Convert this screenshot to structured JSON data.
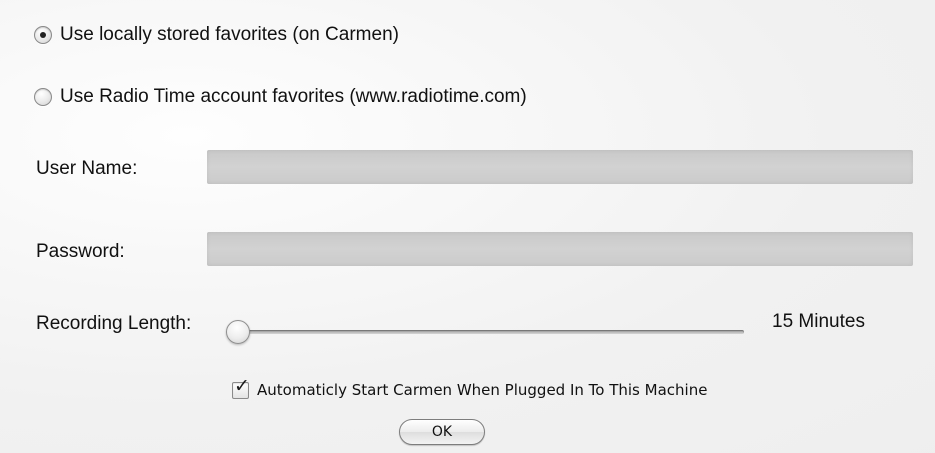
{
  "favorites_source": {
    "options": [
      {
        "label": "Use locally stored favorites (on Carmen)",
        "selected": true
      },
      {
        "label": "Use Radio Time account favorites (www.radiotime.com)",
        "selected": false
      }
    ]
  },
  "account": {
    "username_label": "User Name:",
    "username_value": "",
    "password_label": "Password:",
    "password_value": ""
  },
  "recording": {
    "label": "Recording Length:",
    "value_text": "15 Minutes",
    "slider_fraction": 0.0
  },
  "autostart": {
    "label": "Automaticly Start Carmen When Plugged In To This Machine",
    "checked": true,
    "check_glyph": "✓"
  },
  "actions": {
    "ok_label": "OK"
  },
  "colors": {
    "field_background": "#cdcdcd",
    "panel_background": "#f3f3f3"
  },
  "icons": {
    "radio_selected": "radio-selected-icon",
    "radio_unselected": "radio-unselected-icon",
    "checkbox_checked": "checkmark-icon",
    "slider_thumb": "slider-thumb-icon"
  }
}
